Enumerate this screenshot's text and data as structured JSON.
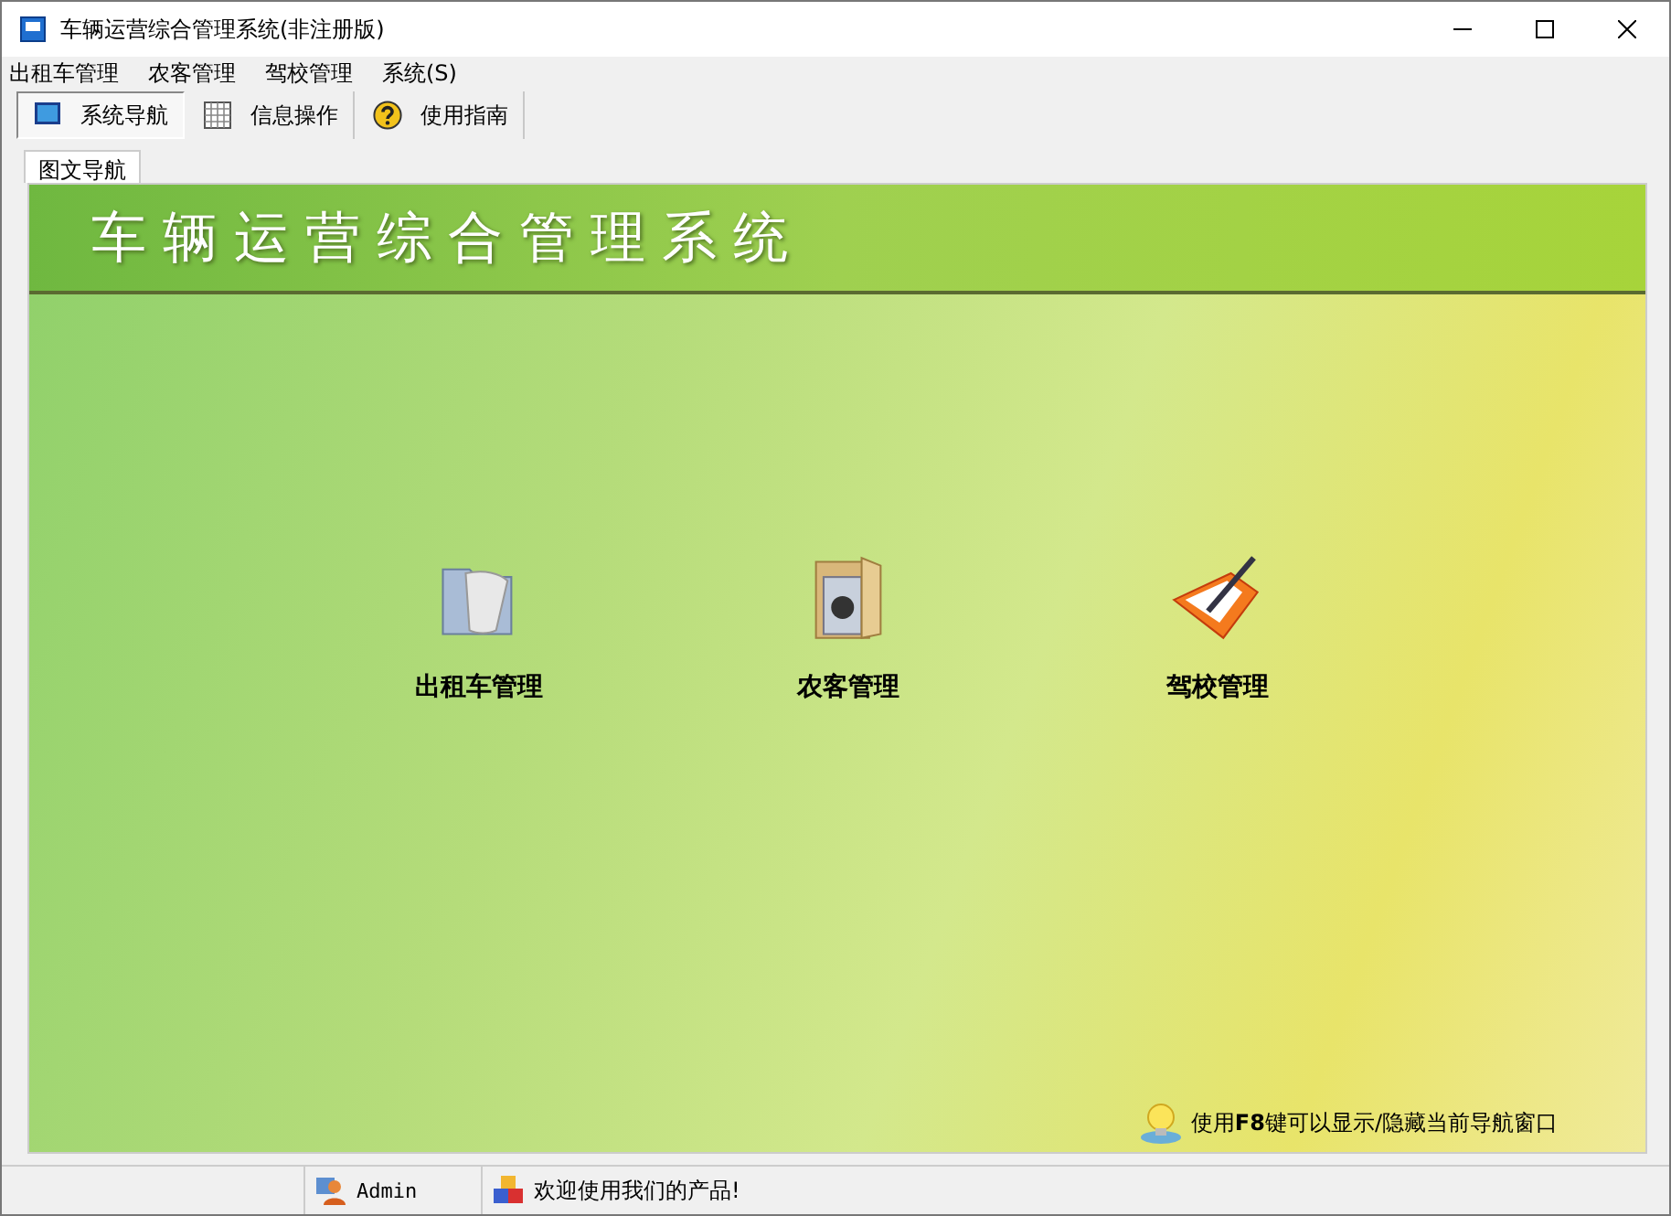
{
  "window": {
    "title": "车辆运营综合管理系统(非注册版)"
  },
  "menu": [
    "出租车管理",
    "农客管理",
    "驾校管理",
    "系统(S)"
  ],
  "toolbar": [
    {
      "label": "系统导航",
      "kind": "monitor",
      "selected": true
    },
    {
      "label": "信息操作",
      "kind": "grid",
      "selected": false
    },
    {
      "label": "使用指南",
      "kind": "help",
      "selected": false
    }
  ],
  "tabs": [
    {
      "label": "图文导航",
      "selected": true
    }
  ],
  "banner": {
    "title": "车辆运营综合管理系统"
  },
  "modules": [
    {
      "label": "出租车管理",
      "kind": "folder-doc"
    },
    {
      "label": "农客管理",
      "kind": "folder-disc"
    },
    {
      "label": "驾校管理",
      "kind": "pen-folder"
    }
  ],
  "hint": {
    "text": "使用**F8**键可以显示/隐藏当前导航窗口"
  },
  "status_bar": {
    "user": "Admin",
    "message": "欢迎使用我们的产品!"
  }
}
